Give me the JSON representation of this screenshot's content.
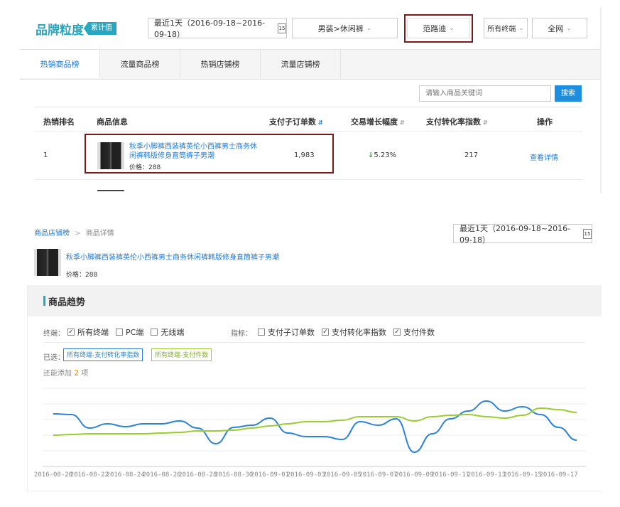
{
  "header": {
    "title": "品牌粒度",
    "badge": "累计值",
    "date_range": "最近1天（2016-09-18~2016-09-18）",
    "calendar_day": "15",
    "category": "男装>休闲裤",
    "brand": "范路迪",
    "terminal": "所有终端",
    "region": "全网"
  },
  "tabs": [
    "热销商品榜",
    "流量商品榜",
    "热销店铺榜",
    "流量店铺榜"
  ],
  "search": {
    "placeholder": "请输入商品关键词",
    "button": "搜索"
  },
  "table": {
    "columns": [
      "热销排名",
      "商品信息",
      "支付子订单数",
      "交易增长幅度",
      "支付转化率指数",
      "操作"
    ],
    "rows": [
      {
        "rank": "1",
        "title_line1": "秋季小脚裤西装裤英伦小西裤男士商务休",
        "title_line2": "闲裤韩版修身直筒裤子男潮",
        "price": "价格：288",
        "orders": "1,983",
        "growth": "5.23%",
        "conversion": "217",
        "action": "查看详情"
      }
    ]
  },
  "detail": {
    "breadcrumb_link": "商品店铺榜",
    "breadcrumb_sep": ">",
    "breadcrumb_current": "商品详情",
    "date_range": "最近1天（2016-09-18~2016-09-18）",
    "calendar_day": "15",
    "product_title": "秋季小脚裤西装裤英伦小西裤男士商务休闲裤韩版修身直筒裤子男潮",
    "price": "价格：288",
    "section_title": "商品趋势",
    "terminal_label": "终端：",
    "terminals": [
      {
        "label": "所有终端",
        "checked": "true"
      },
      {
        "label": "PC端",
        "checked": "false"
      },
      {
        "label": "无线端",
        "checked": "false"
      }
    ],
    "metric_label": "指标：",
    "metrics": [
      {
        "label": "支付子订单数",
        "checked": "false"
      },
      {
        "label": "支付转化率指数",
        "checked": "true"
      },
      {
        "label": "支付件数",
        "checked": "true"
      }
    ],
    "selected_label": "已选：",
    "selected_tags": [
      "所有终端-支付转化率指数",
      "所有终端-支付件数"
    ],
    "remaining_prefix": "还能添加",
    "remaining_count": "2",
    "remaining_suffix": "项"
  },
  "colors": {
    "accent": "#1e7bd9",
    "teal": "#27a7c0",
    "blue_series": "#2a83d8",
    "green_series": "#9acd32",
    "highlight": "#7a1a1a"
  },
  "chart_data": {
    "type": "line",
    "x": [
      "2016-08-20",
      "2016-08-21",
      "2016-08-22",
      "2016-08-23",
      "2016-08-24",
      "2016-08-25",
      "2016-08-26",
      "2016-08-27",
      "2016-08-28",
      "2016-08-29",
      "2016-08-30",
      "2016-08-31",
      "2016-09-01",
      "2016-09-02",
      "2016-09-03",
      "2016-09-04",
      "2016-09-05",
      "2016-09-06",
      "2016-09-07",
      "2016-09-08",
      "2016-09-09",
      "2016-09-10",
      "2016-09-11",
      "2016-09-12",
      "2016-09-13",
      "2016-09-14",
      "2016-09-15",
      "2016-09-16",
      "2016-09-17",
      "2016-09-18"
    ],
    "xticks": [
      "2016-08-20",
      "2016-08-22",
      "2016-08-24",
      "2016-08-26",
      "2016-08-28",
      "2016-08-30",
      "2016-09-01",
      "2016-09-03",
      "2016-09-05",
      "2016-09-07",
      "2016-09-09",
      "2016-09-11",
      "2016-09-13",
      "2016-09-15",
      "2016-09-17"
    ],
    "series": [
      {
        "color": "#2a83d8",
        "values": [
          74,
          73,
          54,
          60,
          56,
          60,
          60,
          64,
          54,
          32,
          55,
          58,
          68,
          47,
          42,
          42,
          38,
          63,
          58,
          67,
          20,
          46,
          67,
          78,
          92,
          78,
          84,
          73,
          55,
          37
        ]
      },
      {
        "color": "#9acd32",
        "values": [
          44,
          45,
          46,
          46,
          46,
          46,
          47,
          48,
          50,
          50,
          51,
          54,
          57,
          60,
          63,
          63,
          65,
          70,
          70,
          70,
          64,
          70,
          72,
          73,
          70,
          68,
          72,
          82,
          80,
          76
        ]
      }
    ],
    "ylim": [
      0,
      110
    ],
    "grid": true
  }
}
